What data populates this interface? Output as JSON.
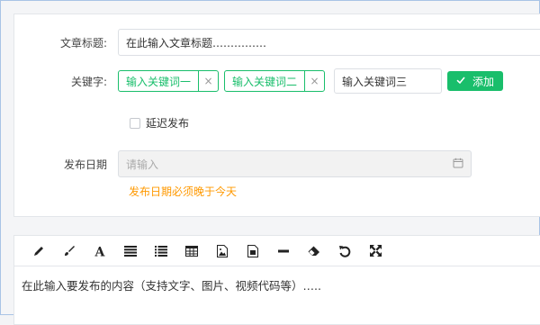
{
  "form": {
    "title_label": "文章标题:",
    "title_value": "在此输入文章标题……………",
    "keywords_label": "关键字:",
    "keywords": [
      {
        "text": "输入关键词一"
      },
      {
        "text": "输入关键词二"
      }
    ],
    "tag_close": "×",
    "keyword_input_value": "输入关键词三",
    "add_button": "添加",
    "delay_label": "延迟发布",
    "date_label": "发布日期",
    "date_placeholder": "请输入",
    "date_hint": "发布日期必须晚于今天"
  },
  "editor": {
    "toolbar": [
      "pencil-icon",
      "brush-icon",
      "font-icon",
      "align-justify-icon",
      "list-icon",
      "table-icon",
      "image-icon",
      "file-icon",
      "horizontal-rule-icon",
      "eraser-icon",
      "undo-icon",
      "fullscreen-icon"
    ],
    "content": "在此输入要发布的内容（支持文字、图片、视频代码等）….."
  },
  "colors": {
    "accent": "#19be6b",
    "warning": "#ff9900",
    "border": "#dcdfe4"
  }
}
